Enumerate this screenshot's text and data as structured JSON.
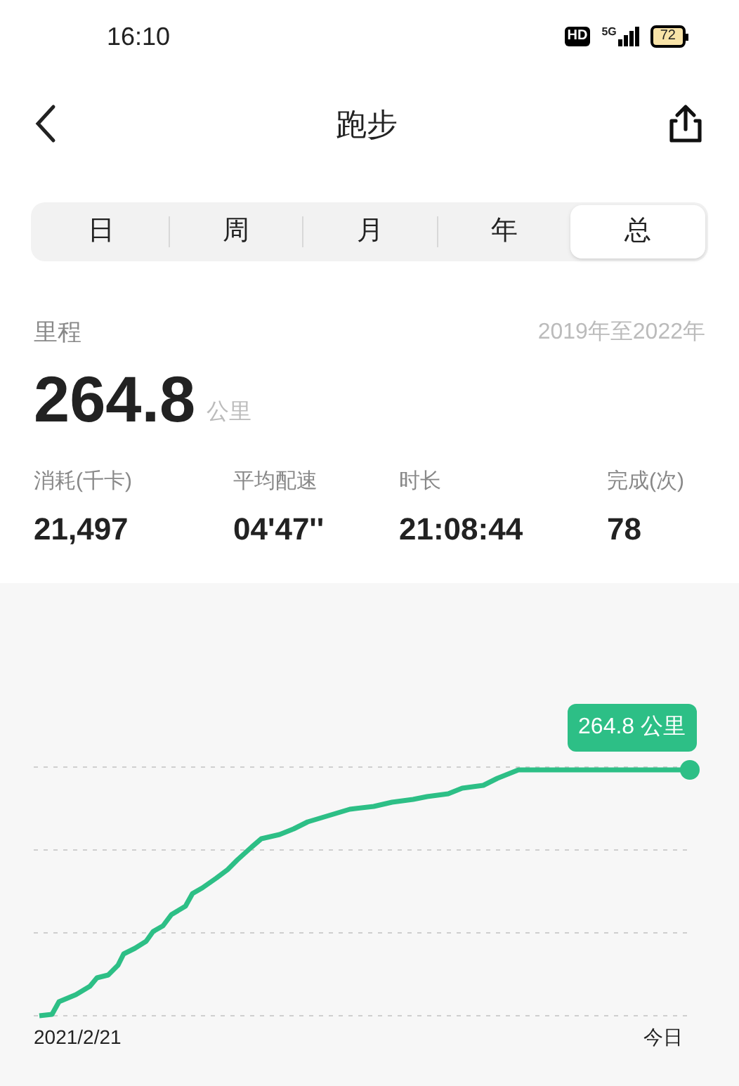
{
  "status_bar": {
    "time": "16:10",
    "hd": "HD",
    "network": "5G",
    "battery": "72"
  },
  "header": {
    "title": "跑步"
  },
  "tabs": [
    {
      "label": "日",
      "selected": false
    },
    {
      "label": "周",
      "selected": false
    },
    {
      "label": "月",
      "selected": false
    },
    {
      "label": "年",
      "selected": false
    },
    {
      "label": "总",
      "selected": true
    }
  ],
  "distance": {
    "label": "里程",
    "range": "2019年至2022年",
    "value": "264.8",
    "unit": "公里"
  },
  "stats": [
    {
      "label": "消耗(千卡)",
      "value": "21,497"
    },
    {
      "label": "平均配速",
      "value": "04'47''"
    },
    {
      "label": "时长",
      "value": "21:08:44"
    },
    {
      "label": "完成(次)",
      "value": "78"
    }
  ],
  "chart": {
    "tooltip": "264.8 公里",
    "x_start": "2021/2/21",
    "x_end": "今日"
  }
}
